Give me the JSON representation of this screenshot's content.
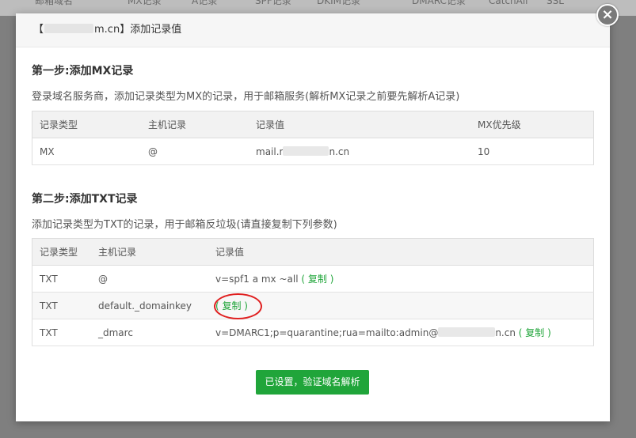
{
  "background": {
    "columns": [
      "邮箱域名",
      "MX记录",
      "A记录",
      "SPF记录",
      "DKIM记录",
      "DMARC记录",
      "CatchAll",
      "SSL"
    ]
  },
  "modal": {
    "title_prefix": "【",
    "title_domain_suffix": "m.cn",
    "title_rest": "】添加记录值",
    "close_label": "×"
  },
  "step1": {
    "title": "第一步:添加MX记录",
    "desc": "登录域名服务商，添加记录类型为MX的记录，用于邮箱服务(解析MX记录之前要先解析A记录)",
    "headers": [
      "记录类型",
      "主机记录",
      "记录值",
      "MX优先级"
    ],
    "row": {
      "type": "MX",
      "host": "@",
      "value_prefix": "mail.r",
      "value_suffix": "n.cn",
      "priority": "10"
    }
  },
  "step2": {
    "title": "第二步:添加TXT记录",
    "desc": "添加记录类型为TXT的记录，用于邮箱反垃圾(请直接复制下列参数)",
    "headers": [
      "记录类型",
      "主机记录",
      "记录值"
    ],
    "copy_label": "( 复制 )",
    "rows": [
      {
        "type": "TXT",
        "host": "@",
        "value": "v=spf1 a mx ~all",
        "value_suffix": ""
      },
      {
        "type": "TXT",
        "host": "default._domainkey",
        "value": "",
        "value_suffix": ""
      },
      {
        "type": "TXT",
        "host": "_dmarc",
        "value": "v=DMARC1;p=quarantine;rua=mailto:admin@",
        "value_suffix": "n.cn"
      }
    ]
  },
  "confirm_button": "已设置，验证域名解析",
  "colors": {
    "accent": "#20a53a",
    "annotation": "#e02020"
  }
}
